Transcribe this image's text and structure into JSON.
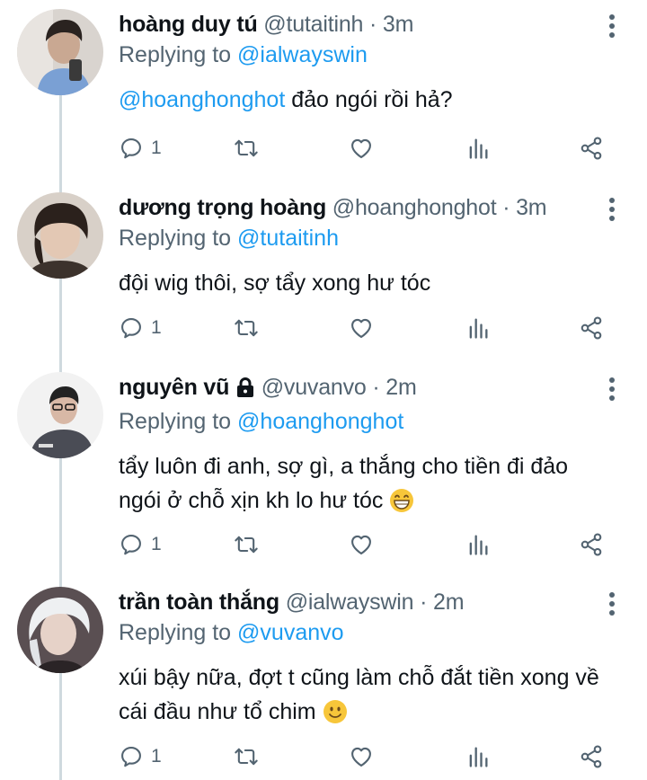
{
  "tweets": [
    {
      "name": "hoàng duy tú",
      "handle": "@tutaitinh",
      "sep": " · ",
      "time": "3m",
      "replying_prefix": "Replying to ",
      "replying_to": "@ialwayswin",
      "mention": "@hoanghonghot",
      "text": " đảo ngói rồi hả?",
      "reply_count": "1"
    },
    {
      "name": "dương trọng hoàng",
      "handle": "@hoanghonghot",
      "sep": " · ",
      "time": "3m",
      "replying_prefix": "Replying to ",
      "replying_to": "@tutaitinh",
      "text": "đội wig thôi, sợ tẩy xong hư tóc",
      "reply_count": "1"
    },
    {
      "name": "nguyên vũ",
      "handle": "@vuvanvo",
      "sep": " · ",
      "time": "2m",
      "replying_prefix": "Replying to ",
      "replying_to": "@hoanghonghot",
      "text_line1": "tẩy luôn đi anh, sợ gì, a thắng cho tiền đi đảo",
      "text_line2": "ngói ở chỗ xịn kh lo hư tóc",
      "reply_count": "1",
      "protected": true,
      "emoji": "grinning-face"
    },
    {
      "name": "trần toàn thắng",
      "handle": "@ialwayswin",
      "sep": " · ",
      "time": "2m",
      "replying_prefix": "Replying to ",
      "replying_to": "@vuvanvo",
      "text_line1": "xúi bậy nữa, đợt t cũng làm chỗ đắt tiền xong về",
      "text_line2": "cái đầu như tổ chim",
      "reply_count": "1",
      "emoji": "slightly-smiling-face"
    }
  ],
  "colors": {
    "accent": "#1d9bf0",
    "muted": "#536471",
    "text": "#0f1419",
    "thread_line": "#cfd9de"
  },
  "icons": [
    "reply-icon",
    "retweet-icon",
    "like-icon",
    "analytics-icon",
    "share-icon",
    "more-icon",
    "lock-icon"
  ]
}
